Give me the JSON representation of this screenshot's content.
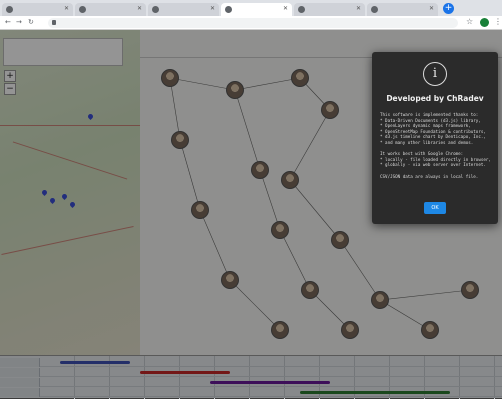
{
  "modal": {
    "info_icon": "info-circle-icon",
    "title": "Developed by ChRadev",
    "body_lines": [
      "This software is implemented thanks to:",
      "* Data-Driven Documents (d3.js) library,",
      "* OpenLayers dynamic maps framework,",
      "* OpenStreetMap Foundation & contributors,",
      "* d3.js timeline chart by Denticapo, Inc.,",
      "* and many other libraries and demos.",
      "",
      "It works best with Google Chrome:",
      "* locally - file loaded directly in browser,",
      "* globally - via web server over Internet.",
      "",
      "CSV/JSON data are always in local file."
    ],
    "ok_label": "OK",
    "background_color": "#2b2b2b",
    "button_color": "#1e88e5"
  },
  "browser": {
    "new_tab_icon": "plus-icon",
    "lock_icon": "lock-icon",
    "profile_color": "#188038"
  },
  "map": {
    "pin_color": "#3b4fd8"
  }
}
